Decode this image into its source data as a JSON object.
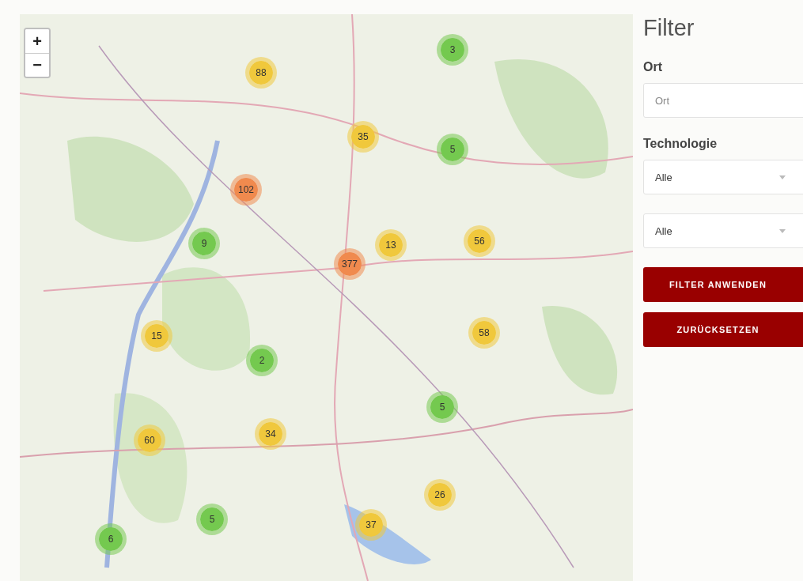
{
  "map": {
    "zoom_controls": [
      "+",
      "−"
    ],
    "clusters": [
      {
        "count": "3",
        "color": "#74c94f"
      },
      {
        "count": "88",
        "color": "#f0c83c"
      },
      {
        "count": "35",
        "color": "#f0c83c"
      },
      {
        "count": "5",
        "color": "#74c94f"
      },
      {
        "count": "102",
        "color": "#f08a4e"
      },
      {
        "count": "9",
        "color": "#74c94f"
      },
      {
        "count": "13",
        "color": "#f0c83c"
      },
      {
        "count": "56",
        "color": "#f0c83c"
      },
      {
        "count": "377",
        "color": "#f08a4e"
      },
      {
        "count": "15",
        "color": "#f0c83c"
      },
      {
        "count": "58",
        "color": "#f0c83c"
      },
      {
        "count": "2",
        "color": "#74c94f"
      },
      {
        "count": "5",
        "color": "#74c94f"
      },
      {
        "count": "60",
        "color": "#f0c83c"
      },
      {
        "count": "34",
        "color": "#f0c83c"
      },
      {
        "count": "26",
        "color": "#f0c83c"
      },
      {
        "count": "5",
        "color": "#74c94f"
      },
      {
        "count": "37",
        "color": "#f0c83c"
      },
      {
        "count": "6",
        "color": "#74c94f"
      }
    ]
  },
  "filter": {
    "title": "Filter",
    "fields": [
      {
        "kind": "input",
        "label": "Ort",
        "placeholder": "Ort"
      },
      {
        "kind": "select",
        "label": "Technologie",
        "value": "Alle"
      },
      {
        "kind": "select",
        "value": "Alle"
      }
    ],
    "buttons": [
      "FILTER ANWENDEN",
      "ZURÜCKSETZEN"
    ]
  }
}
